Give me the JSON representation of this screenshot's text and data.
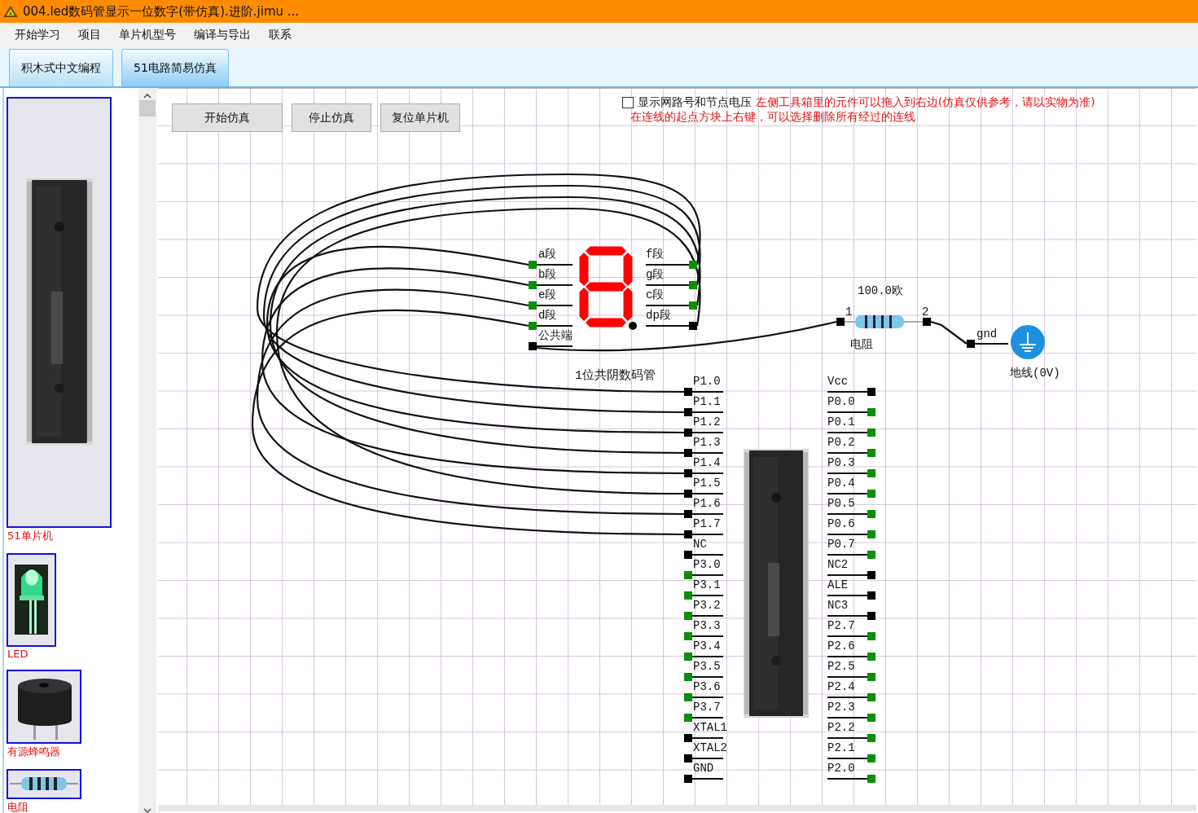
{
  "window": {
    "title": "004.led数码管显示一位数字(带仿真).进阶.jimu ..."
  },
  "menu": [
    "开始学习",
    "项目",
    "单片机型号",
    "编译与导出",
    "联系"
  ],
  "tabs": [
    {
      "label": "积木式中文编程",
      "selected": false
    },
    {
      "label": "51电路简易仿真",
      "selected": true
    }
  ],
  "toolbox": {
    "items": [
      {
        "label": "51单片机",
        "kind": "mcu"
      },
      {
        "label": "LED",
        "kind": "led"
      },
      {
        "label": "有源蜂鸣器",
        "kind": "buzzer"
      },
      {
        "label": "电阻",
        "kind": "resistor"
      }
    ]
  },
  "toolbar": {
    "buttons": [
      "开始仿真",
      "停止仿真",
      "复位单片机"
    ]
  },
  "options": {
    "checkbox": {
      "label": "显示网路号和节点电压",
      "checked": false
    },
    "hints": [
      "左侧工具箱里的元件可以拖入到右边(仿真仅供参考，请以实物为准)",
      "在连线的起点方块上右键，可以选择删除所有经过的连线"
    ]
  },
  "display": {
    "name": "1位共阴数码管",
    "left_pins": [
      {
        "label": "a段",
        "high": true
      },
      {
        "label": "b段",
        "high": true
      },
      {
        "label": "e段",
        "high": true
      },
      {
        "label": "d段",
        "high": true
      },
      {
        "label": "公共端",
        "high": false
      }
    ],
    "right_pins": [
      {
        "label": "f段",
        "high": true
      },
      {
        "label": "g段",
        "high": true
      },
      {
        "label": "c段",
        "high": true
      },
      {
        "label": "dp段",
        "high": false
      }
    ],
    "segments": [
      {
        "on": true
      },
      {
        "on": true
      },
      {
        "on": true
      },
      {
        "on": true
      },
      {
        "on": true
      },
      {
        "on": true
      },
      {
        "on": true
      }
    ],
    "decimal_point": {
      "on": false
    }
  },
  "resistor": {
    "value": "100.0欧",
    "name": "电阻",
    "pins": [
      "1",
      "2"
    ]
  },
  "ground": {
    "pin": "gnd",
    "name": "地线(0V)"
  },
  "mcu": {
    "left_pins": [
      {
        "label": "P1.0",
        "high": false
      },
      {
        "label": "P1.1",
        "high": false
      },
      {
        "label": "P1.2",
        "high": false
      },
      {
        "label": "P1.3",
        "high": false
      },
      {
        "label": "P1.4",
        "high": false
      },
      {
        "label": "P1.5",
        "high": false
      },
      {
        "label": "P1.6",
        "high": false
      },
      {
        "label": "P1.7",
        "high": false
      },
      {
        "label": "NC",
        "high": false
      },
      {
        "label": "P3.0",
        "high": true
      },
      {
        "label": "P3.1",
        "high": true
      },
      {
        "label": "P3.2",
        "high": true
      },
      {
        "label": "P3.3",
        "high": true
      },
      {
        "label": "P3.4",
        "high": true
      },
      {
        "label": "P3.5",
        "high": true
      },
      {
        "label": "P3.6",
        "high": true
      },
      {
        "label": "P3.7",
        "high": true
      },
      {
        "label": "XTAL1",
        "high": false
      },
      {
        "label": "XTAL2",
        "high": false
      },
      {
        "label": "GND",
        "high": false
      }
    ],
    "right_pins": [
      {
        "label": "Vcc",
        "high": false
      },
      {
        "label": "P0.0",
        "high": true
      },
      {
        "label": "P0.1",
        "high": true
      },
      {
        "label": "P0.2",
        "high": true
      },
      {
        "label": "P0.3",
        "high": true
      },
      {
        "label": "P0.4",
        "high": true
      },
      {
        "label": "P0.5",
        "high": true
      },
      {
        "label": "P0.6",
        "high": true
      },
      {
        "label": "P0.7",
        "high": true
      },
      {
        "label": "NC2",
        "high": false
      },
      {
        "label": "ALE",
        "high": false
      },
      {
        "label": "NC3",
        "high": false
      },
      {
        "label": "P2.7",
        "high": true
      },
      {
        "label": "P2.6",
        "high": true
      },
      {
        "label": "P2.5",
        "high": true
      },
      {
        "label": "P2.4",
        "high": true
      },
      {
        "label": "P2.3",
        "high": true
      },
      {
        "label": "P2.2",
        "high": true
      },
      {
        "label": "P2.1",
        "high": true
      },
      {
        "label": "P2.0",
        "high": true
      }
    ]
  }
}
